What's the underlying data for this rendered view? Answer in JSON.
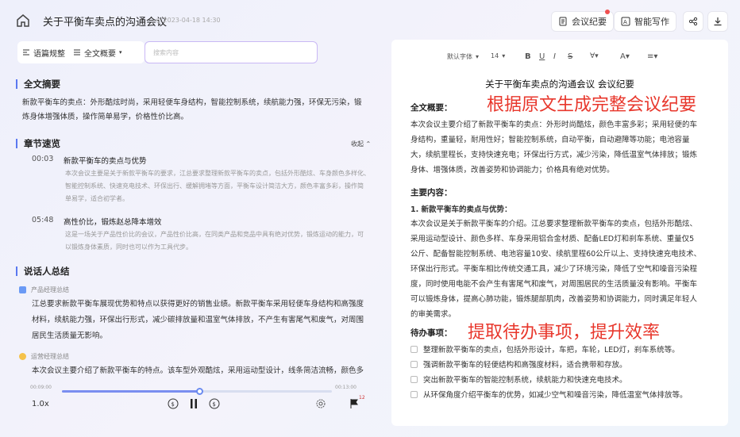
{
  "header": {
    "title": "关于平衡车卖点的沟通会议",
    "subtitle": "◎ 2023-04-18 14:30",
    "btn_minutes": "会议纪要",
    "btn_writing": "智能写作"
  },
  "left": {
    "tool_overview": "语篇规整",
    "tool_select": "全文概要",
    "search_placeholder": "搜索内容",
    "summary_title": "全文摘要",
    "summary_text_1": "新款平衡车的卖点：外形酷炫时尚，采用轻便车身结构，智能控制系统，续航能力强，环保无污染，锻",
    "summary_text_2": "炼身体增强体质，操作简单易学，价格性价比高。",
    "chapters_title": "章节速览",
    "collapse_label": "收起",
    "chapters": [
      {
        "time": "00:03",
        "title": "新款平衡车的卖点与优势",
        "d1": "本次会议主要是关于新款平衡车的要求，江总要求整理新款平衡车的卖点，包括外形酷炫、车身颜色多样化、",
        "d2": "智能控制系统、快速充电技术、环保出行、缓解拥堵等方面，平衡车设计简洁大方，颜色丰富多彩，操作简",
        "d3": "单易学，适合初学者。"
      },
      {
        "time": "05:48",
        "title": "高性价比，锻炼赵总降本增效",
        "d1": "这是一场关于产品性价比的会议，产品性价比高，在同类产品和竞品中具有绝对优势，锻炼运动的能力，可",
        "d2": "以锻炼身体素质，同时也可以作为工具代步。",
        "d3": ""
      }
    ],
    "speakers_title": "说话人总结",
    "speakers": [
      {
        "role": "产品经理总结",
        "t1": "江总要求新款平衡车展现优势和特点以获得更好的销售业绩。新款平衡车采用轻便车身结构和高强度",
        "t2": "材料，续航能力强，环保出行形式，减少碳排放量和温室气体排放，不产生有害尾气和废气，对周围",
        "t3": "居民生活质量无影响。"
      },
      {
        "role": "运营经理总结",
        "t1": "本次会议主要介绍了新款平衡车的特点。该车型外观酷炫，采用运动型设计，线条简洁流畅，颜色多",
        "t2": "",
        "t3": ""
      }
    ],
    "player": {
      "current": "00:09:00",
      "total": "00:13:00",
      "progress": 0.51,
      "speed": "1.0x",
      "flag_count": "12"
    }
  },
  "editor": {
    "font": "默认字体",
    "size": "14",
    "doc_title": "关于平衡车卖点的沟通会议 会议纪要",
    "overlay_1": "根据原文生成完整会议纪要",
    "overlay_2": "提取待办事项，提升效率",
    "summary_heading": "全文概要：",
    "summary_lines": [
      "本次会议主要介绍了新款平衡车的卖点：外形时尚酷炫，颜色丰富多彩；采用轻便的车",
      "身结构，重量轻，耐用性好；智能控制系统，自动平衡，自动避障等功能；电池容量",
      "大，续航里程长，支持快速充电；环保出行方式，减少污染，降低温室气体排放；锻炼",
      "身体、增强体质，改善姿势和协调能力；价格具有绝对优势。"
    ],
    "main_heading": "主要内容：",
    "point_heading": "1. 新款平衡车的卖点与优势：",
    "point_lines": [
      "本次会议是关于新款平衡车的介绍。江总要求整理新款平衡车的卖点，包括外形酷炫、",
      "采用运动型设计、颜色多样、车身采用铝合金材质、配备LED灯和刹车系统、重量仅5",
      "公斤、配备智能控制系统、电池容量10安、续航里程60公斤以上、支持快速充电技术、",
      "环保出行形式。平衡车相比传统交通工具，减少了环境污染，降低了空气和噪音污染程",
      "度，同时使用电能不会产生有害尾气和废气，对周围居民的生活质量没有影响。平衡车",
      "可以锻炼身体，提高心肺功能，锻炼腿部肌肉，改善姿势和协调能力，同时满足年轻人",
      "的审美需求。"
    ],
    "todo_heading": "待办事项：",
    "todos": [
      "整理新款平衡车的卖点，包括外形设计，车把，车轮，LED灯，刹车系统等。",
      "强调新款平衡车的轻便结构和高强度材料，适合携带和存放。",
      "突出新款平衡车的智能控制系统，续航能力和快速充电技术。",
      "从环保角度介绍平衡车的优势，如减少空气和噪音污染，降低温室气体排放等。"
    ]
  },
  "colors": {
    "accent": "#5a78f0",
    "overlay_red": "#e8372c"
  }
}
